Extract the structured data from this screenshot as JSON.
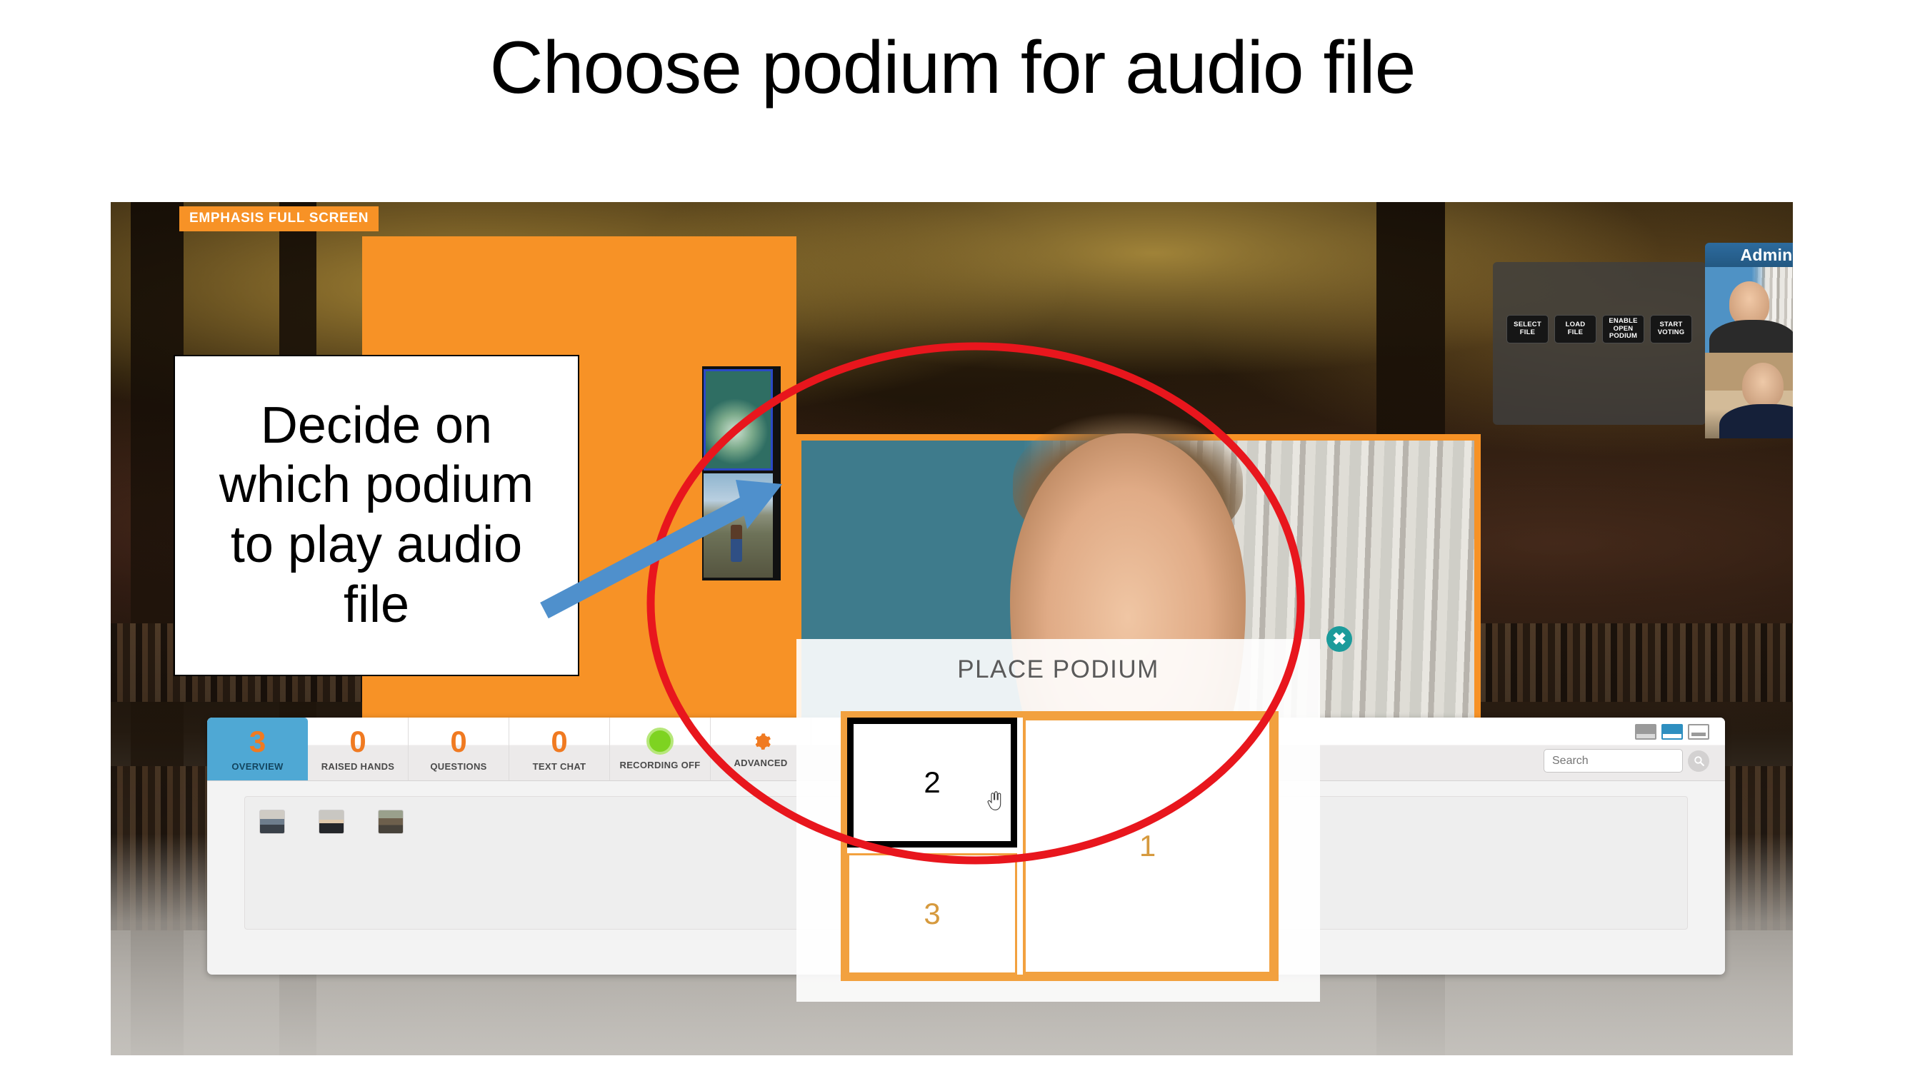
{
  "slide": {
    "title": "Choose podium for audio file"
  },
  "callout": {
    "text": "Decide on which podium to play audio file",
    "arrow_icon": "arrow-up-right-icon",
    "highlight_icon": "ellipse-highlight-icon"
  },
  "stage": {
    "emphasis_badge": "EMPHASIS FULL SCREEN"
  },
  "admin": {
    "label": "Admin",
    "buttons": [
      {
        "name": "select-file",
        "label": "SELECT\nFILE"
      },
      {
        "name": "load-file",
        "label": "LOAD\nFILE"
      },
      {
        "name": "enable-open-podium",
        "label": "ENABLE\nOPEN\nPODIUM"
      },
      {
        "name": "start-voting",
        "label": "START\nVOTING"
      }
    ],
    "feeds": [
      {
        "name": "admin-video-feed-1"
      },
      {
        "name": "admin-video-feed-2"
      }
    ]
  },
  "podium_dialog": {
    "title": "PLACE PODIUM",
    "close_label": "✖",
    "close_icon": "close-icon",
    "cursor_icon": "hand-pointer-icon",
    "cells": [
      {
        "label": "2",
        "selected": true
      },
      {
        "label": "3",
        "selected": false
      },
      {
        "label": "1",
        "selected": false
      }
    ]
  },
  "console": {
    "tabs": [
      {
        "name": "overview",
        "count": "3",
        "label": "OVERVIEW",
        "active": true,
        "icon": ""
      },
      {
        "name": "raised-hands",
        "count": "0",
        "label": "RAISED HANDS",
        "active": false,
        "icon": ""
      },
      {
        "name": "questions",
        "count": "0",
        "label": "QUESTIONS",
        "active": false,
        "icon": ""
      },
      {
        "name": "text-chat",
        "count": "0",
        "label": "TEXT CHAT",
        "active": false,
        "icon": ""
      },
      {
        "name": "recording",
        "count": "",
        "label": "RECORDING OFF",
        "active": false,
        "icon": "record-dot-icon"
      },
      {
        "name": "advanced",
        "count": "",
        "label": "ADVANCED",
        "active": false,
        "icon": "gear-icon"
      }
    ],
    "search": {
      "value": "",
      "placeholder": "Search",
      "icon": "search-icon"
    },
    "layout_buttons": [
      {
        "name": "layout-view-list",
        "active": false,
        "style": "solid"
      },
      {
        "name": "layout-view-grid",
        "active": true,
        "style": "solid"
      },
      {
        "name": "layout-view-detail",
        "active": false,
        "style": "outline"
      }
    ],
    "participants": [
      {
        "name": "participant-avatar-1"
      },
      {
        "name": "participant-avatar-2"
      },
      {
        "name": "participant-avatar-3"
      }
    ]
  },
  "colors": {
    "accent_orange": "#f79226",
    "podium_orange": "#f2a13f",
    "counter_orange": "#f07a21",
    "active_blue": "#4fa8d4",
    "admin_blue": "#2d6b9e",
    "close_teal": "#1c9b9b",
    "annotation_red": "#e8161d",
    "annotation_blue": "#4f90cc",
    "recording_green": "#7ed321"
  }
}
